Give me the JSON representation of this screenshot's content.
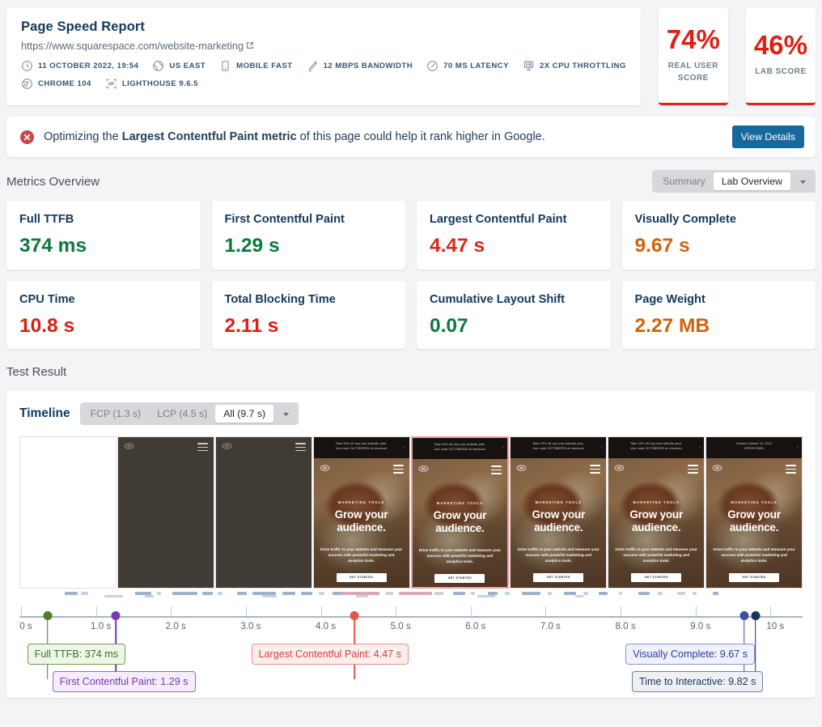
{
  "report": {
    "title": "Page Speed Report",
    "url": "https://www.squarespace.com/website-marketing",
    "external_link_icon": "external-link-icon",
    "meta_row_1": [
      {
        "icon": "clock-icon",
        "label": "11 OCTOBER 2022, 19:54"
      },
      {
        "icon": "globe-icon",
        "label": "US EAST"
      },
      {
        "icon": "mobile-icon",
        "label": "MOBILE FAST"
      },
      {
        "icon": "bandwidth-icon",
        "label": "12 MBPS BANDWIDTH"
      },
      {
        "icon": "latency-gauge-icon",
        "label": "70 MS LATENCY"
      },
      {
        "icon": "cpu-icon",
        "label": "2X CPU THROTTLING"
      }
    ],
    "meta_row_2": [
      {
        "icon": "chrome-icon",
        "label": "CHROME 104"
      },
      {
        "icon": "lighthouse-icon",
        "label": "LIGHTHOUSE 9.6.5"
      }
    ]
  },
  "scores": [
    {
      "value": "74%",
      "label": "REAL USER SCORE",
      "color": "#dc2015"
    },
    {
      "value": "46%",
      "label": "LAB SCORE",
      "color": "#dc2015"
    }
  ],
  "alert": {
    "icon": "error-circle-icon",
    "prefix": "Optimizing the ",
    "emphasis": "Largest Contentful Paint metric",
    "suffix": " of this page could help it rank higher in Google.",
    "button": "View Details"
  },
  "metrics_section": {
    "title": "Metrics Overview",
    "segments": [
      {
        "label": "Summary",
        "selected": false
      },
      {
        "label": "Lab Overview",
        "selected": true
      }
    ],
    "caret_icon": "chevron-down-icon"
  },
  "metrics": [
    {
      "label": "Full TTFB",
      "value": "374 ms",
      "color": "#0a7a3c"
    },
    {
      "label": "First Contentful Paint",
      "value": "1.29 s",
      "color": "#0a7a3c"
    },
    {
      "label": "Largest Contentful Paint",
      "value": "4.47 s",
      "color": "#d8281b"
    },
    {
      "label": "Visually Complete",
      "value": "9.67 s",
      "color": "#d2620c"
    },
    {
      "label": "CPU Time",
      "value": "10.8 s",
      "color": "#e01b12"
    },
    {
      "label": "Total Blocking Time",
      "value": "2.11 s",
      "color": "#e01b12"
    },
    {
      "label": "Cumulative Layout Shift",
      "value": "0.07",
      "color": "#0a7a3c"
    },
    {
      "label": "Page Weight",
      "value": "2.27 MB",
      "color": "#d2620c"
    }
  ],
  "test_result": {
    "title": "Test Result",
    "timeline_title": "Timeline",
    "filters": [
      {
        "label": "FCP (1.3 s)",
        "selected": false
      },
      {
        "label": "LCP (4.5 s)",
        "selected": false
      },
      {
        "label": "All (9.7 s)",
        "selected": true
      }
    ],
    "caret_icon": "chevron-down-icon"
  },
  "chart_data": {
    "type": "timeline",
    "title": "Timeline",
    "xlabel": "",
    "xlim": [
      0,
      10.45
    ],
    "grid": false,
    "tick_labels": [
      "0 s",
      "1.0 s",
      "2.0 s",
      "3.0 s",
      "4.0 s",
      "5.0 s",
      "6.0 s",
      "7.0 s",
      "8.0 s",
      "9.0 s",
      "10 s"
    ],
    "tick_values": [
      0,
      1,
      2,
      3,
      4,
      5,
      6,
      7,
      8,
      9,
      10
    ],
    "markers": [
      {
        "name": "Full TTFB",
        "value": 0.374,
        "label": "Full TTFB: 374 ms",
        "color": "#4f7d22",
        "style": "green"
      },
      {
        "name": "First Contentful Paint",
        "value": 1.29,
        "label": "First Contentful Paint: 1.29 s",
        "color": "#7a37b5",
        "style": "purple"
      },
      {
        "name": "Largest Contentful Paint",
        "value": 4.47,
        "label": "Largest Contentful Paint: 4.47 s",
        "color": "#e8534b",
        "style": "red"
      },
      {
        "name": "Visually Complete",
        "value": 9.67,
        "label": "Visually Complete: 9.67 s",
        "color": "#3b4fa8",
        "style": "blue"
      },
      {
        "name": "Time to Interactive",
        "value": 9.82,
        "label": "Time to Interactive: 9.82 s",
        "color": "#17355a",
        "style": "navy"
      }
    ],
    "frames": [
      {
        "index": 1,
        "kind": "blank",
        "selected": false
      },
      {
        "index": 2,
        "kind": "dark",
        "selected": false
      },
      {
        "index": 3,
        "kind": "dark",
        "selected": false
      },
      {
        "index": 4,
        "kind": "hero",
        "selected": false
      },
      {
        "index": 5,
        "kind": "hero",
        "selected": true
      },
      {
        "index": 6,
        "kind": "hero",
        "selected": false
      },
      {
        "index": 7,
        "kind": "hero",
        "selected": false
      },
      {
        "index": 8,
        "kind": "hero-alt",
        "selected": false
      }
    ],
    "frame_content": {
      "banner": "Take 20% off any new website plan.\nUse code OCTOBER20 at checkout",
      "banner_alt": "Expires October 15, 2022\nOFFER ENDS",
      "eyebrow": "MARKETING TOOLS",
      "headline_line1": "Grow your",
      "headline_line2": "audience.",
      "subtext": "Drive traffic to your website and measure your success with powerful marketing and analytics tools.",
      "cta": "GET STARTED"
    },
    "waterfall_bars": [
      {
        "x": 5.8,
        "w": 1.6,
        "row": 0,
        "c": "#9db3c9"
      },
      {
        "x": 7.8,
        "w": 1.0,
        "row": 0,
        "c": "#c4d3e2"
      },
      {
        "x": 14.8,
        "w": 2.0,
        "row": 0,
        "c": "#9db3c9"
      },
      {
        "x": 17.6,
        "w": 0.5,
        "row": 0,
        "c": "#c4d3e2"
      },
      {
        "x": 19.5,
        "w": 3.2,
        "row": 0,
        "c": "#9db3c9"
      },
      {
        "x": 23.3,
        "w": 1.4,
        "row": 0,
        "c": "#9db3c9"
      },
      {
        "x": 25.3,
        "w": 0.6,
        "row": 0,
        "c": "#c4d3e2"
      },
      {
        "x": 27.8,
        "w": 1.2,
        "row": 0,
        "c": "#9db3c9"
      },
      {
        "x": 29.8,
        "w": 3.0,
        "row": 0,
        "c": "#9db3c9"
      },
      {
        "x": 33.6,
        "w": 1.6,
        "row": 0,
        "c": "#9db3c9"
      },
      {
        "x": 36.0,
        "w": 1.4,
        "row": 0,
        "c": "#9db3c9"
      },
      {
        "x": 38.2,
        "w": 0.7,
        "row": 0,
        "c": "#c4d3e2"
      },
      {
        "x": 40.0,
        "w": 3.4,
        "row": 0,
        "c": "#9db3c9"
      },
      {
        "x": 44.4,
        "w": 1.6,
        "row": 0,
        "c": "#9db3c9"
      },
      {
        "x": 46.8,
        "w": 0.9,
        "row": 0,
        "c": "#c4d3e2"
      },
      {
        "x": 49.0,
        "w": 3.1,
        "row": 0,
        "c": "#9db3c9"
      },
      {
        "x": 53.0,
        "w": 1.1,
        "row": 0,
        "c": "#c4d3e2"
      },
      {
        "x": 55.4,
        "w": 1.5,
        "row": 0,
        "c": "#9db3c9"
      },
      {
        "x": 57.6,
        "w": 0.6,
        "row": 0,
        "c": "#c4d3e2"
      },
      {
        "x": 59.8,
        "w": 1.3,
        "row": 0,
        "c": "#9db3c9"
      },
      {
        "x": 62.0,
        "w": 0.6,
        "row": 0,
        "c": "#c4d3e2"
      },
      {
        "x": 64.2,
        "w": 2.3,
        "row": 0,
        "c": "#9db3c9"
      },
      {
        "x": 67.5,
        "w": 0.5,
        "row": 0,
        "c": "#c4d3e2"
      },
      {
        "x": 69.5,
        "w": 1.6,
        "row": 0,
        "c": "#9db3c9"
      },
      {
        "x": 72.0,
        "w": 0.6,
        "row": 0,
        "c": "#c4d3e2"
      },
      {
        "x": 74.0,
        "w": 1.1,
        "row": 0,
        "c": "#9db3c9"
      },
      {
        "x": 76.5,
        "w": 0.5,
        "row": 0,
        "c": "#c4d3e2"
      },
      {
        "x": 79.0,
        "w": 1.5,
        "row": 0,
        "c": "#9db3c9"
      },
      {
        "x": 81.5,
        "w": 0.6,
        "row": 0,
        "c": "#c4d3e2"
      },
      {
        "x": 84.0,
        "w": 1.0,
        "row": 0,
        "c": "#c4d3e2"
      },
      {
        "x": 86.0,
        "w": 0.5,
        "row": 0,
        "c": "#c4d3e2"
      },
      {
        "x": 88.5,
        "w": 0.8,
        "row": 0,
        "c": "#9db3c9"
      },
      {
        "x": 41.0,
        "w": 5.0,
        "row": 0,
        "c": "#dba7b9"
      },
      {
        "x": 48.5,
        "w": 4.2,
        "row": 0,
        "c": "#dba7b9"
      },
      {
        "x": 10.8,
        "w": 2.4,
        "row": 1,
        "c": "#c4d3e2"
      },
      {
        "x": 16.0,
        "w": 1.2,
        "row": 1,
        "c": "#c4d3e2"
      },
      {
        "x": 31.0,
        "w": 1.9,
        "row": 1,
        "c": "#c4d3e2"
      },
      {
        "x": 43.0,
        "w": 1.5,
        "row": 1,
        "c": "#c4d3e2"
      },
      {
        "x": 58.5,
        "w": 2.2,
        "row": 1,
        "c": "#c4d3e2"
      },
      {
        "x": 71.0,
        "w": 1.0,
        "row": 1,
        "c": "#c4d3e2"
      }
    ]
  }
}
